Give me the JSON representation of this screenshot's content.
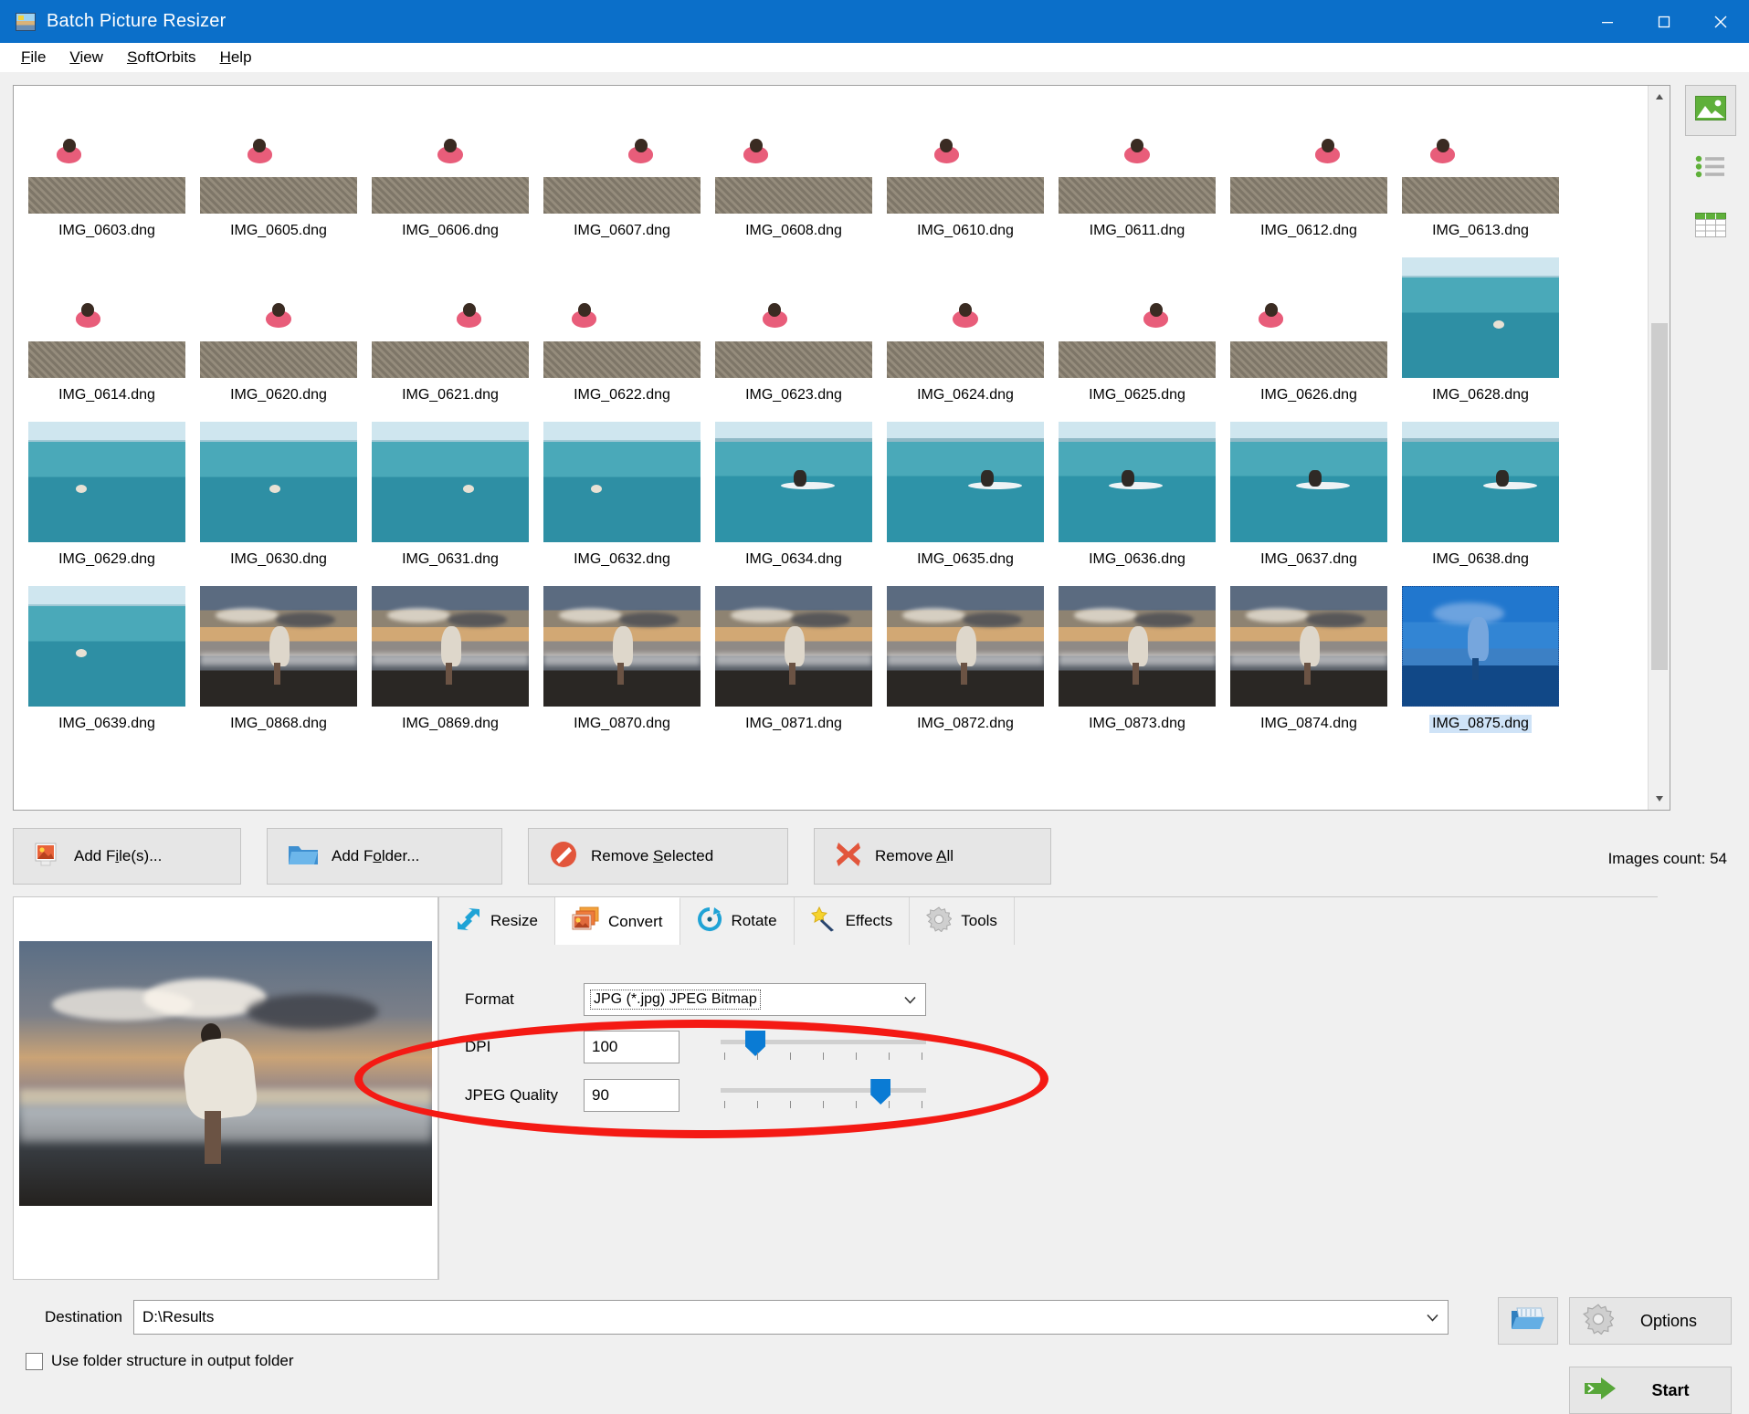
{
  "window": {
    "title": "Batch Picture Resizer",
    "app_icon": "picture-icon",
    "minimize": "minimize-icon",
    "maximize": "maximize-icon",
    "close": "close-icon"
  },
  "menubar": {
    "items": [
      {
        "label": "File",
        "accel": "F"
      },
      {
        "label": "View",
        "accel": "V"
      },
      {
        "label": "SoftOrbits",
        "accel": "S"
      },
      {
        "label": "Help",
        "accel": "H"
      }
    ]
  },
  "view_toolbar": {
    "buttons": [
      {
        "name": "thumbnails-view",
        "icon": "image-icon",
        "active": true
      },
      {
        "name": "list-view",
        "icon": "list-icon",
        "active": false
      },
      {
        "name": "details-view",
        "icon": "table-icon",
        "active": false
      }
    ]
  },
  "thumbnails": {
    "items": [
      {
        "name": "IMG_0603.dng",
        "scene": "wave",
        "selected": false
      },
      {
        "name": "IMG_0605.dng",
        "scene": "wave",
        "selected": false
      },
      {
        "name": "IMG_0606.dng",
        "scene": "wave",
        "selected": false
      },
      {
        "name": "IMG_0607.dng",
        "scene": "wave",
        "selected": false
      },
      {
        "name": "IMG_0608.dng",
        "scene": "wave",
        "selected": false
      },
      {
        "name": "IMG_0610.dng",
        "scene": "wave",
        "selected": false
      },
      {
        "name": "IMG_0611.dng",
        "scene": "wave",
        "selected": false
      },
      {
        "name": "IMG_0612.dng",
        "scene": "wave",
        "selected": false
      },
      {
        "name": "IMG_0613.dng",
        "scene": "wave",
        "selected": false
      },
      {
        "name": "IMG_0614.dng",
        "scene": "wave",
        "selected": false
      },
      {
        "name": "IMG_0620.dng",
        "scene": "wave",
        "selected": false
      },
      {
        "name": "IMG_0621.dng",
        "scene": "wave",
        "selected": false
      },
      {
        "name": "IMG_0622.dng",
        "scene": "wave",
        "selected": false
      },
      {
        "name": "IMG_0623.dng",
        "scene": "wave",
        "selected": false
      },
      {
        "name": "IMG_0624.dng",
        "scene": "wave",
        "selected": false
      },
      {
        "name": "IMG_0625.dng",
        "scene": "wave",
        "selected": false
      },
      {
        "name": "IMG_0626.dng",
        "scene": "wave",
        "selected": false
      },
      {
        "name": "IMG_0628.dng",
        "scene": "sea",
        "selected": false
      },
      {
        "name": "IMG_0629.dng",
        "scene": "sea",
        "selected": false
      },
      {
        "name": "IMG_0630.dng",
        "scene": "sea",
        "selected": false
      },
      {
        "name": "IMG_0631.dng",
        "scene": "sea",
        "selected": false
      },
      {
        "name": "IMG_0632.dng",
        "scene": "sea",
        "selected": false
      },
      {
        "name": "IMG_0634.dng",
        "scene": "sup",
        "selected": false
      },
      {
        "name": "IMG_0635.dng",
        "scene": "sup",
        "selected": false
      },
      {
        "name": "IMG_0636.dng",
        "scene": "sup",
        "selected": false
      },
      {
        "name": "IMG_0637.dng",
        "scene": "sup",
        "selected": false
      },
      {
        "name": "IMG_0638.dng",
        "scene": "sup",
        "selected": false
      },
      {
        "name": "IMG_0639.dng",
        "scene": "sea",
        "selected": false
      },
      {
        "name": "IMG_0868.dng",
        "scene": "sunset",
        "selected": false
      },
      {
        "name": "IMG_0869.dng",
        "scene": "sunset",
        "selected": false
      },
      {
        "name": "IMG_0870.dng",
        "scene": "sunset",
        "selected": false
      },
      {
        "name": "IMG_0871.dng",
        "scene": "sunset",
        "selected": false
      },
      {
        "name": "IMG_0872.dng",
        "scene": "sunset",
        "selected": false
      },
      {
        "name": "IMG_0873.dng",
        "scene": "sunset",
        "selected": false
      },
      {
        "name": "IMG_0874.dng",
        "scene": "sunset",
        "selected": false
      },
      {
        "name": "IMG_0875.dng",
        "scene": "bluesky",
        "selected": true
      }
    ]
  },
  "toolbar": {
    "add_files": "Add File(s)...",
    "add_files_accel": "i",
    "add_folder": "Add Folder...",
    "add_folder_accel": "o",
    "remove_selected": "Remove Selected",
    "remove_selected_accel": "S",
    "remove_all": "Remove All",
    "remove_all_accel": "A",
    "images_count": "Images count: 54"
  },
  "tabs": [
    {
      "label": "Resize",
      "icon": "resize-arrows-icon",
      "active": false
    },
    {
      "label": "Convert",
      "icon": "convert-images-icon",
      "active": true
    },
    {
      "label": "Rotate",
      "icon": "rotate-icon",
      "active": false
    },
    {
      "label": "Effects",
      "icon": "magic-wand-icon",
      "active": false
    },
    {
      "label": "Tools",
      "icon": "gear-icon",
      "active": false
    }
  ],
  "convert": {
    "format_label": "Format",
    "format_value": "JPG (*.jpg) JPEG Bitmap",
    "dpi_label": "DPI",
    "dpi_value": "100",
    "dpi_slider_percent": 12,
    "jpeg_quality_label": "JPEG Quality",
    "jpeg_quality_value": "90",
    "jpeg_quality_slider_percent": 73
  },
  "annotation": {
    "shape": "red-ellipse-highlight",
    "color": "#f41a14"
  },
  "footer": {
    "destination_label": "Destination",
    "destination_value": "D:\\Results",
    "browse_icon": "open-folder-icon",
    "use_folder_structure_label": "Use folder structure in output folder",
    "use_folder_structure_checked": false,
    "options_label": "Options",
    "options_icon": "gear-icon",
    "start_label": "Start",
    "start_icon": "green-arrow-icon"
  },
  "colors": {
    "titlebar": "#0b6fc9",
    "accent_blue": "#0a7bd4",
    "annotation_red": "#f41a14",
    "start_green": "#57a639"
  }
}
